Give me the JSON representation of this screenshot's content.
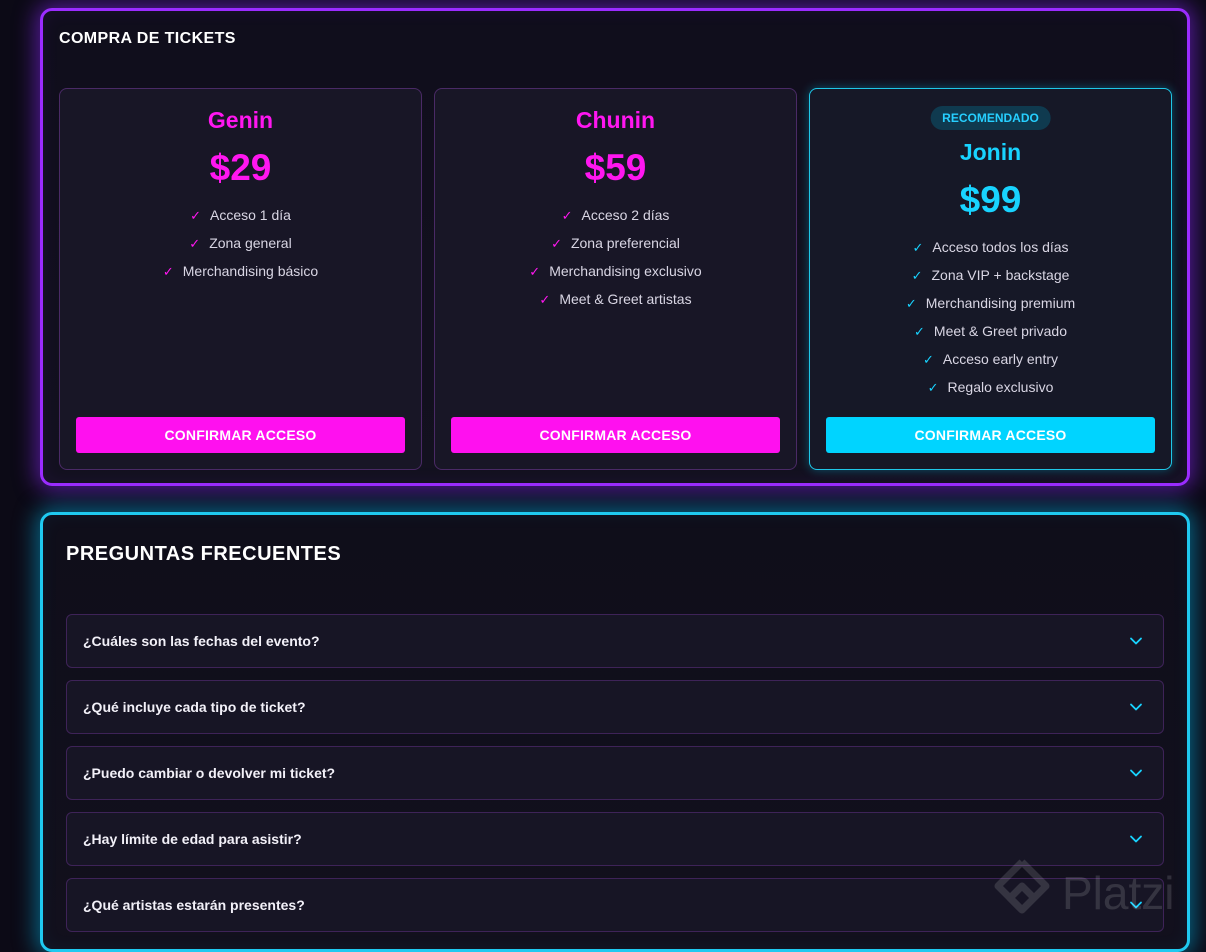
{
  "tickets": {
    "title": "COMPRA DE TICKETS",
    "cards": [
      {
        "name": "Genin",
        "price": "$29",
        "features": [
          "Acceso 1 día",
          "Zona general",
          "Merchandising básico"
        ],
        "button": "CONFIRMAR ACCESO",
        "accent": "#ff10ef"
      },
      {
        "name": "Chunin",
        "price": "$59",
        "features": [
          "Acceso 2 días",
          "Zona preferencial",
          "Merchandising exclusivo",
          "Meet & Greet artistas"
        ],
        "button": "CONFIRMAR ACCESO",
        "accent": "#ff10ef"
      },
      {
        "badge": "RECOMENDADO",
        "name": "Jonin",
        "price": "$99",
        "features": [
          "Acceso todos los días",
          "Zona VIP + backstage",
          "Merchandising premium",
          "Meet & Greet privado",
          "Acceso early entry",
          "Regalo exclusivo"
        ],
        "button": "CONFIRMAR ACCESO",
        "accent": "#00d4ff"
      }
    ]
  },
  "faq": {
    "title": "PREGUNTAS FRECUENTES",
    "items": [
      "¿Cuáles son las fechas del evento?",
      "¿Qué incluye cada tipo de ticket?",
      "¿Puedo cambiar o devolver mi ticket?",
      "¿Hay límite de edad para asistir?",
      "¿Qué artistas estarán presentes?"
    ]
  },
  "watermark": "Platzi",
  "colors": {
    "tickets_border": "#9b2cff",
    "faq_border": "#1fc9f0",
    "pink": "#ff16f0",
    "cyan": "#18d3ff",
    "background": "#0c0a16"
  }
}
